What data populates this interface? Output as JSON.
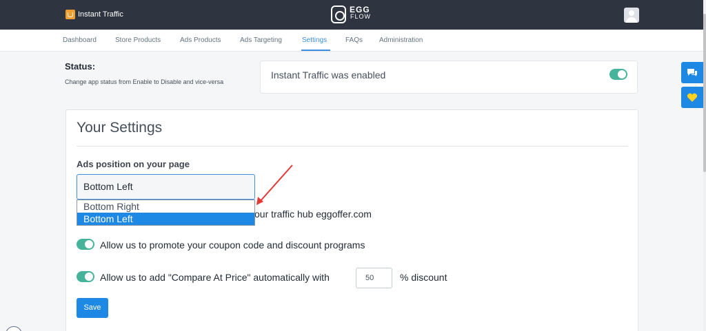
{
  "header": {
    "app_name": "Instant Traffic",
    "brand": {
      "egg": "EGG",
      "flow": "FLOW"
    },
    "colors": {
      "background": "#2e3440",
      "logo": "#f0a030"
    }
  },
  "nav": {
    "items": [
      "Dashboard",
      "Store Products",
      "Ads Products",
      "Ads Targeting",
      "Settings",
      "FAQs",
      "Administration"
    ],
    "active": "Settings"
  },
  "status": {
    "title": "Status:",
    "description": "Change app status from Enable to Disable and vice-versa",
    "message": "Instant Traffic was enabled",
    "enabled": true
  },
  "settings": {
    "title": "Your Settings",
    "ads_position": {
      "label": "Ads position on your page",
      "value": "Bottom Left",
      "options": [
        "Bottom Right",
        "Bottom Left"
      ],
      "highlighted": "Bottom Left"
    },
    "partial_text": "our traffic hub eggoffer.com",
    "promote_coupon": {
      "label": "Allow us to promote your coupon code and discount programs",
      "enabled": true
    },
    "compare_price": {
      "label": "Allow us to add \"Compare At Price\" automatically with",
      "value": "50",
      "suffix": "% discount",
      "enabled": true
    },
    "save_label": "Save"
  },
  "side_widgets": [
    "chat-icon",
    "heart-icon"
  ],
  "colors": {
    "accent": "#1e88e5",
    "toggle_on": "#47b39a",
    "annotation": "#e53935"
  }
}
